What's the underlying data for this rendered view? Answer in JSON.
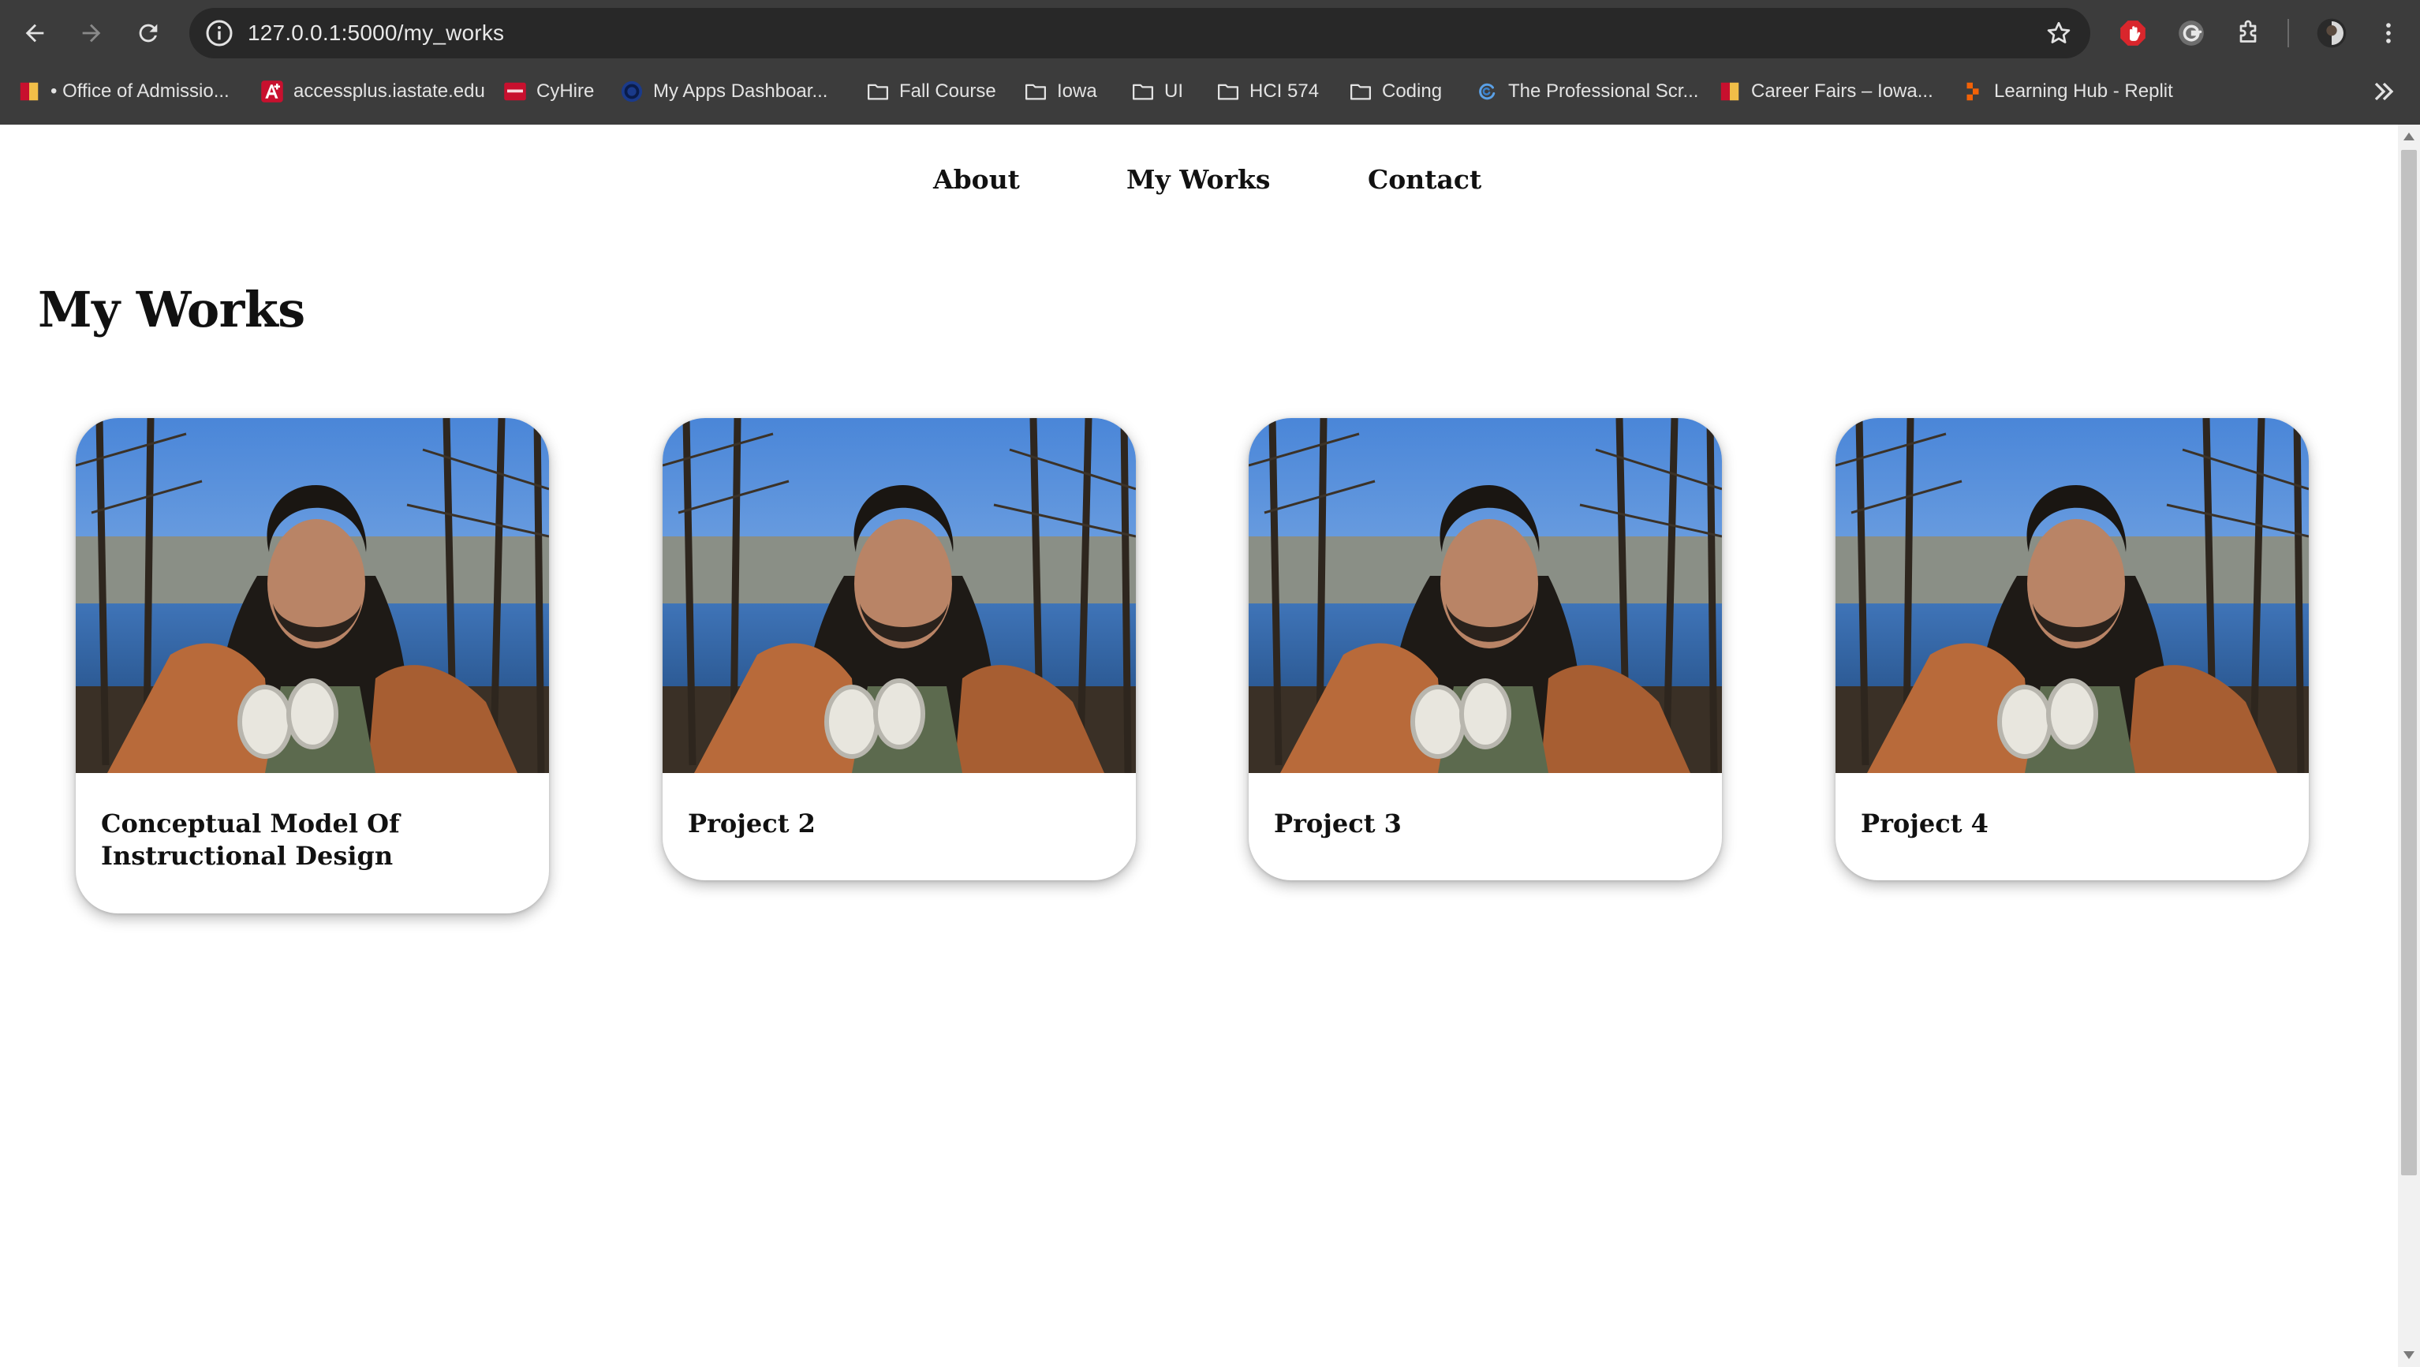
{
  "browser": {
    "url": "127.0.0.1:5000/my_works",
    "bookmarks": [
      {
        "label": "• Office of Admissio...",
        "icon": "isu-flag-icon",
        "color": "#e8b400"
      },
      {
        "label": "accessplus.iastate.edu",
        "icon": "aplus-icon",
        "color": "#c8102e"
      },
      {
        "label": "CyHire",
        "icon": "cyhire-icon",
        "color": "#c8102e"
      },
      {
        "label": "My Apps Dashboar...",
        "icon": "apps-circle-icon",
        "color": "#1a3a8a"
      },
      {
        "label": "Fall Course",
        "icon": "folder-icon"
      },
      {
        "label": "Iowa",
        "icon": "folder-icon"
      },
      {
        "label": "UI",
        "icon": "folder-icon"
      },
      {
        "label": "HCI 574",
        "icon": "folder-icon"
      },
      {
        "label": "Coding",
        "icon": "folder-icon"
      },
      {
        "label": "The Professional Scr...",
        "icon": "swirl-icon",
        "color": "#5aa0e6"
      },
      {
        "label": "Career Fairs – Iowa...",
        "icon": "isu-flag-icon",
        "color": "#e8b400"
      },
      {
        "label": "Learning Hub - Replit",
        "icon": "replit-icon",
        "color": "#f26207"
      }
    ]
  },
  "nav": {
    "about": "About",
    "my_works": "My Works",
    "contact": "Contact"
  },
  "page": {
    "title": "My Works"
  },
  "projects": [
    {
      "title": "Conceptual Model Of Instructional Design"
    },
    {
      "title": "Project 2"
    },
    {
      "title": "Project 3"
    },
    {
      "title": "Project 4"
    }
  ]
}
